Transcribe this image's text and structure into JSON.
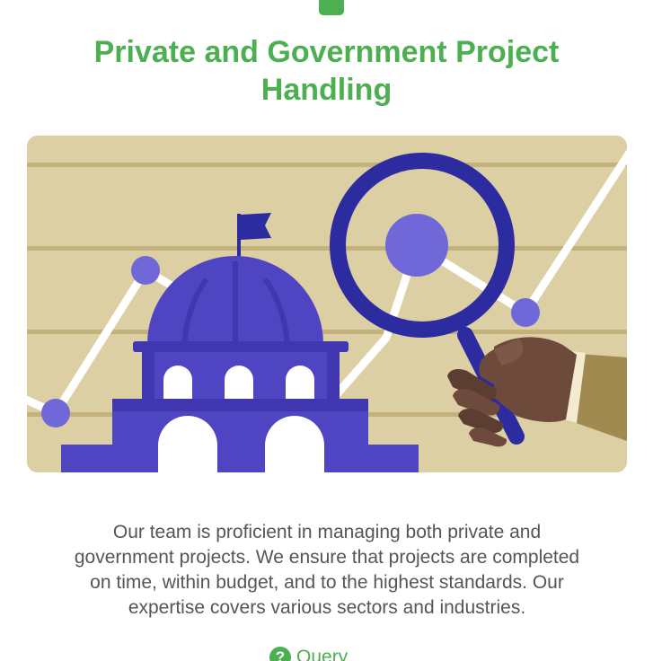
{
  "section": {
    "title_line_1": "Private and Government Project",
    "title_line_2": "Handling",
    "description_line_1": "Our team is proficient in managing both private and",
    "description_line_2": "government projects. We ensure that projects are completed",
    "description_line_3": "on time, within budget, and to the highest standards. Our",
    "description_line_4": "expertise covers various sectors and industries.",
    "query_label": "Query",
    "query_icon": "?"
  },
  "colors": {
    "accent": "#4caf50",
    "body_text": "#555555",
    "illustration_background": "#dccfa4",
    "building": "#4f45c2",
    "magnifier": "#2d2ba0"
  },
  "icons": {
    "top_marker": "green-square-icon",
    "illustration": "government-building-magnifier-illustration",
    "query": "question-circle-icon"
  }
}
